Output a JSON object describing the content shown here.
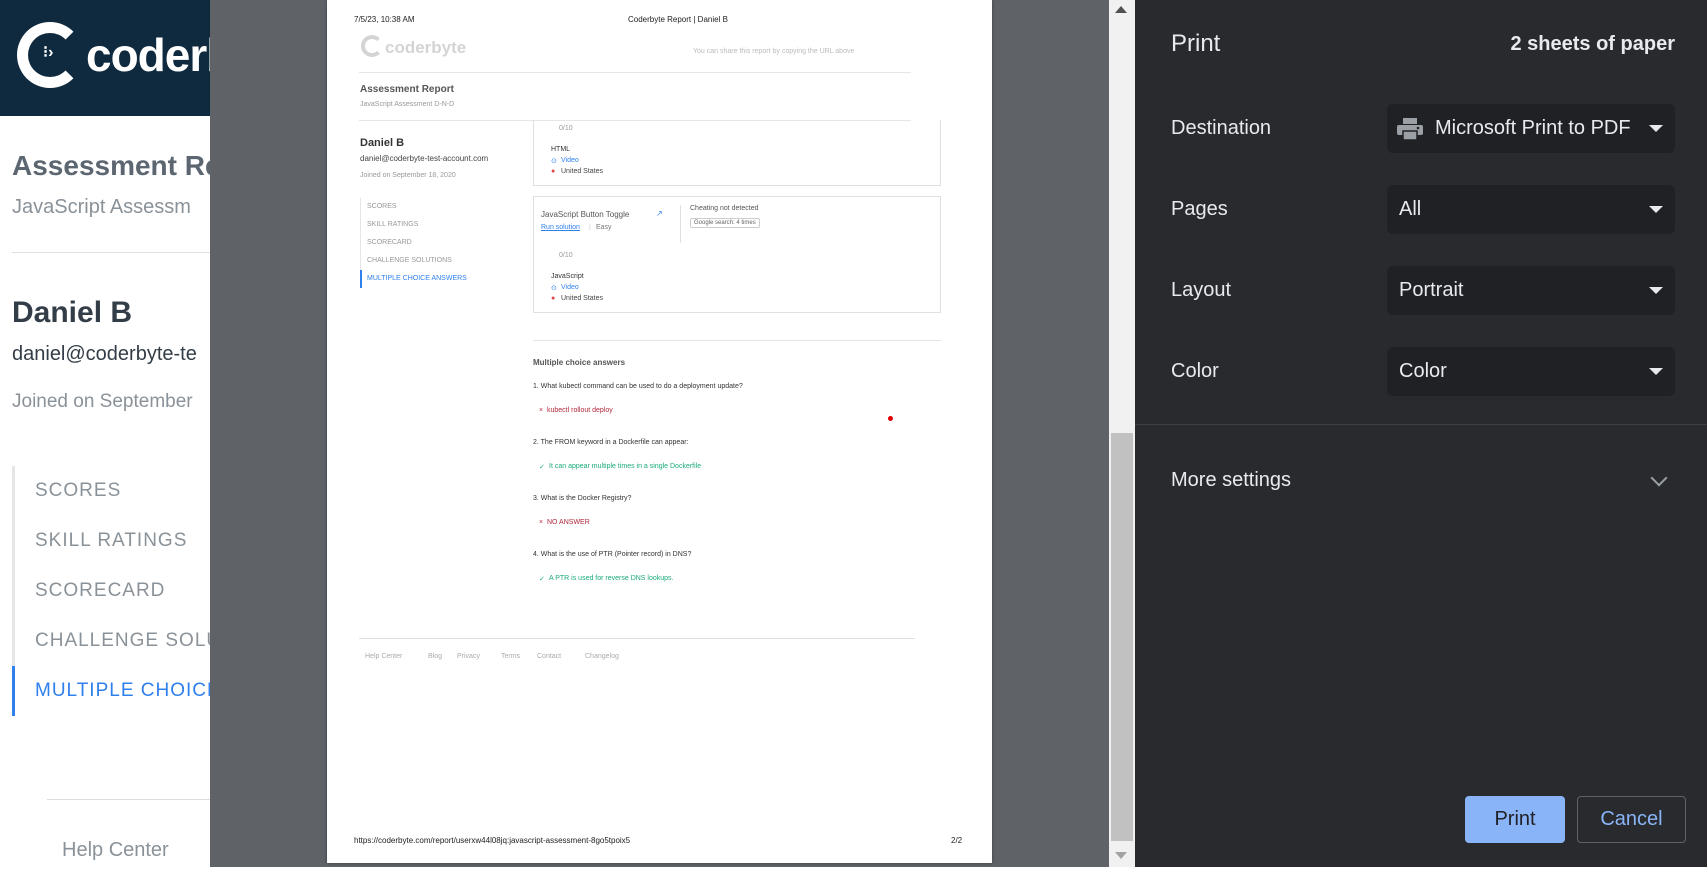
{
  "background_page": {
    "logo_text": "coderb",
    "title": "Assessment Re",
    "subtitle": "JavaScript Assessm",
    "candidate_name": "Daniel B",
    "email": "daniel@coderbyte-te",
    "joined": "Joined on September",
    "nav": [
      "SCORES",
      "SKILL RATINGS",
      "SCORECARD",
      "CHALLENGE SOLUT",
      "MULTIPLE CHOICE"
    ],
    "footer_link": "Help Center"
  },
  "preview": {
    "header_datetime": "7/5/23, 10:38 AM",
    "header_title": "Coderbyte Report | Daniel B",
    "logo_text": "coderbyte",
    "share_note": "You can share this report by copying the URL above",
    "report_title": "Assessment Report",
    "report_subtitle": "JavaScript Assessment D-N-D",
    "candidate_name": "Daniel B",
    "email": "daniel@coderbyte-test-account.com",
    "joined": "Joined on September 18, 2020",
    "nav": [
      "SCORES",
      "SKILL RATINGS",
      "SCORECARD",
      "CHALLENGE SOLUTIONS",
      "MULTIPLE CHOICE ANSWERS"
    ],
    "card1": {
      "score": "0/10",
      "language": "HTML",
      "video": "Video",
      "country": "United States"
    },
    "card2": {
      "title": "JavaScript Button Toggle",
      "run_solution": "Run solution",
      "difficulty": "Easy",
      "cheating": "Cheating not detected",
      "google_search": "Google search: 4 times",
      "score": "0/10",
      "language": "JavaScript",
      "video": "Video",
      "country": "United States"
    },
    "mc_heading": "Multiple choice answers",
    "questions": [
      {
        "q": "1. What kubectl command can be used to do a deployment update?",
        "mark": "×",
        "a": "kubectl rollout deploy",
        "correct": false
      },
      {
        "q": "2. The FROM keyword in a Dockerfile can appear:",
        "mark": "✓",
        "a": "It can appear multiple times in a single Dockerfile",
        "correct": true
      },
      {
        "q": "3. What is the Docker Registry?",
        "mark": "×",
        "a": "NO ANSWER",
        "correct": false
      },
      {
        "q": "4. What is the use of PTR (Pointer record) in DNS?",
        "mark": "✓",
        "a": "A PTR is used for reverse DNS lookups.",
        "correct": true
      }
    ],
    "footer_links": [
      "Help Center",
      "Blog",
      "Privacy",
      "Terms",
      "Contact",
      "Changelog"
    ],
    "url": "https://coderbyte.com/report/userxw44l08jq:javascript-assessment-8go5tpoix5",
    "page_number": "2/2"
  },
  "print_panel": {
    "title": "Print",
    "sheets": "2 sheets of paper",
    "destination_label": "Destination",
    "destination_value": "Microsoft Print to PDF",
    "pages_label": "Pages",
    "pages_value": "All",
    "layout_label": "Layout",
    "layout_value": "Portrait",
    "color_label": "Color",
    "color_value": "Color",
    "more_settings": "More settings",
    "print_button": "Print",
    "cancel_button": "Cancel"
  },
  "colors": {
    "panel_bg": "#292a2d",
    "select_bg": "#202124",
    "accent_blue": "#8ab4f8",
    "preview_bg": "#5f6368",
    "header_navy": "#0f2a3f",
    "link_blue": "#2f80ed",
    "correct_green": "#1aaa7a",
    "wrong_red": "#b0283a"
  }
}
